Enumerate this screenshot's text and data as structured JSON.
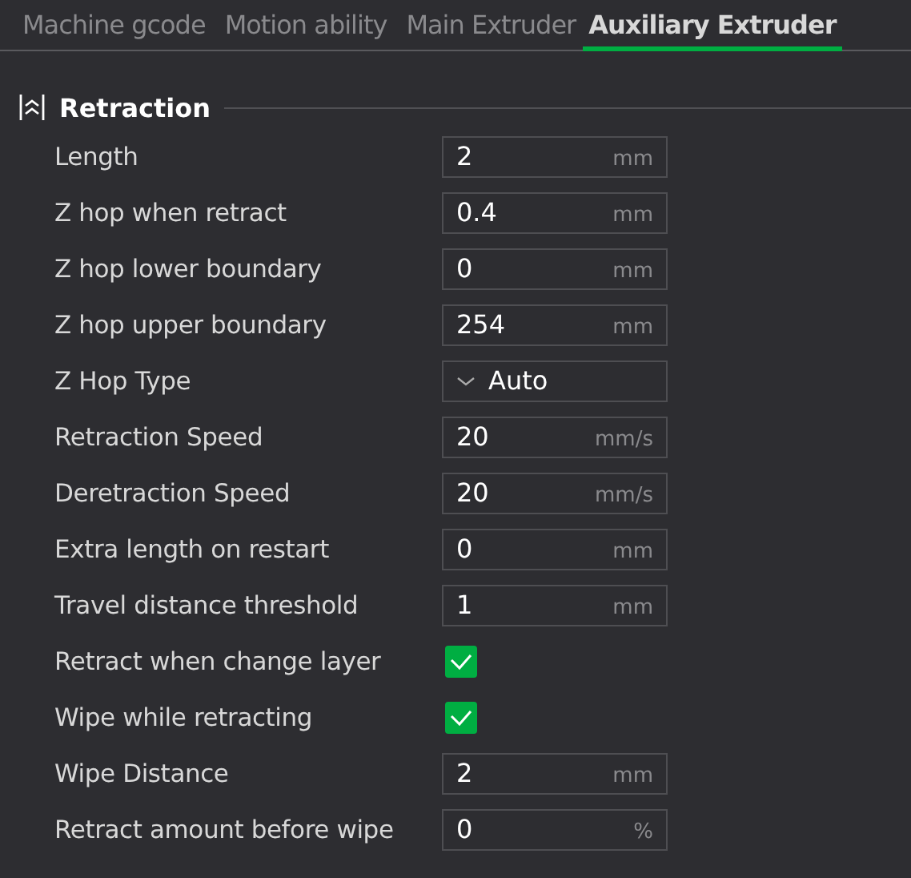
{
  "tabs": [
    {
      "label": "Machine gcode",
      "selected": false
    },
    {
      "label": "Motion ability",
      "selected": false
    },
    {
      "label": "Main Extruder",
      "selected": false
    },
    {
      "label": "Auxiliary Extruder",
      "selected": true
    }
  ],
  "section": {
    "title": "Retraction",
    "expanded": true
  },
  "rows": [
    {
      "kind": "input",
      "label": "Length",
      "value": "2",
      "unit": "mm"
    },
    {
      "kind": "input",
      "label": "Z hop when retract",
      "value": "0.4",
      "unit": "mm"
    },
    {
      "kind": "input",
      "label": "Z hop lower boundary",
      "value": "0",
      "unit": "mm"
    },
    {
      "kind": "input",
      "label": "Z hop upper boundary",
      "value": "254",
      "unit": "mm"
    },
    {
      "kind": "dropdown",
      "label": "Z Hop Type",
      "value": "Auto"
    },
    {
      "kind": "input",
      "label": "Retraction Speed",
      "value": "20",
      "unit": "mm/s"
    },
    {
      "kind": "input",
      "label": "Deretraction Speed",
      "value": "20",
      "unit": "mm/s"
    },
    {
      "kind": "input",
      "label": "Extra length on restart",
      "value": "0",
      "unit": "mm"
    },
    {
      "kind": "input",
      "label": "Travel distance threshold",
      "value": "1",
      "unit": "mm"
    },
    {
      "kind": "checkbox",
      "label": "Retract when change layer",
      "checked": true
    },
    {
      "kind": "checkbox",
      "label": "Wipe while retracting",
      "checked": true
    },
    {
      "kind": "input",
      "label": "Wipe Distance",
      "value": "2",
      "unit": "mm"
    },
    {
      "kind": "input",
      "label": "Retract amount before wipe",
      "value": "0",
      "unit": "%"
    }
  ]
}
